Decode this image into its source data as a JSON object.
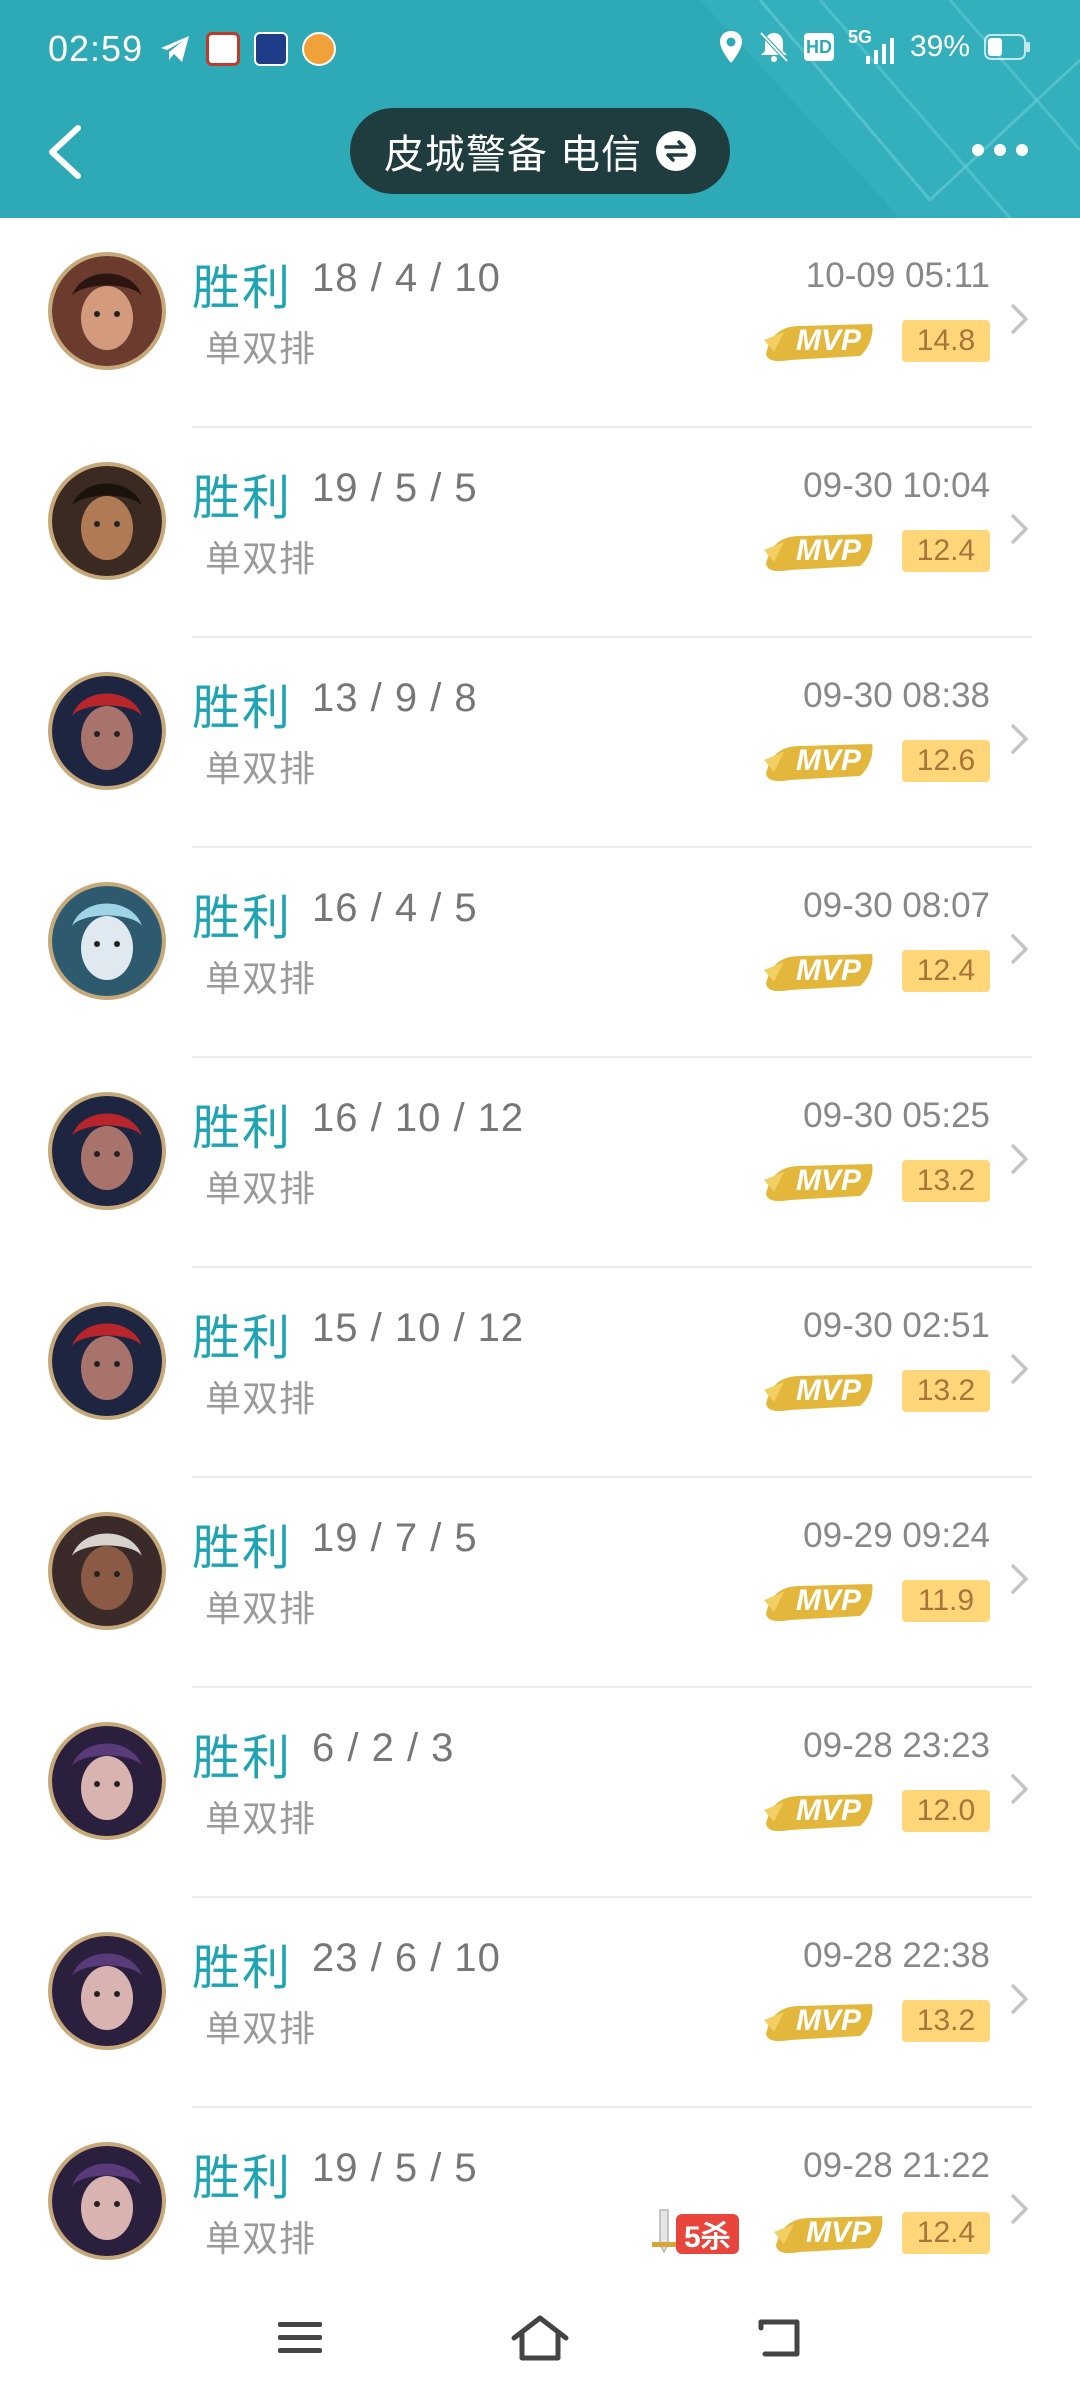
{
  "status_bar": {
    "time": "02:59",
    "network": "5G",
    "hd_label": "HD",
    "battery": "39%"
  },
  "header": {
    "title": "皮城警备 电信",
    "icons": {
      "back": "back-arrow-icon",
      "swap": "swap-icon",
      "more": "more-dots-icon"
    }
  },
  "colors": {
    "header_bg": "#2ea9b6",
    "result_win": "#1fa4b3",
    "score_badge_bg": "#ffd779",
    "mvp_gold": "#e3b73c",
    "penta_red": "#e8453c"
  },
  "matches": [
    {
      "result": "胜利",
      "kda": "18 / 4 / 10",
      "mode": "单双排",
      "time": "10-09 05:11",
      "mvp": "MVP",
      "score": "14.8"
    },
    {
      "result": "胜利",
      "kda": "19 / 5 / 5",
      "mode": "单双排",
      "time": "09-30 10:04",
      "mvp": "MVP",
      "score": "12.4"
    },
    {
      "result": "胜利",
      "kda": "13 / 9 / 8",
      "mode": "单双排",
      "time": "09-30 08:38",
      "mvp": "MVP",
      "score": "12.6"
    },
    {
      "result": "胜利",
      "kda": "16 / 4 / 5",
      "mode": "单双排",
      "time": "09-30 08:07",
      "mvp": "MVP",
      "score": "12.4"
    },
    {
      "result": "胜利",
      "kda": "16 / 10 / 12",
      "mode": "单双排",
      "time": "09-30 05:25",
      "mvp": "MVP",
      "score": "13.2"
    },
    {
      "result": "胜利",
      "kda": "15 / 10 / 12",
      "mode": "单双排",
      "time": "09-30 02:51",
      "mvp": "MVP",
      "score": "13.2"
    },
    {
      "result": "胜利",
      "kda": "19 / 7 / 5",
      "mode": "单双排",
      "time": "09-29 09:24",
      "mvp": "MVP",
      "score": "11.9"
    },
    {
      "result": "胜利",
      "kda": "6 / 2 / 3",
      "mode": "单双排",
      "time": "09-28 23:23",
      "mvp": "MVP",
      "score": "12.0"
    },
    {
      "result": "胜利",
      "kda": "23 / 6 / 10",
      "mode": "单双排",
      "time": "09-28 22:38",
      "mvp": "MVP",
      "score": "13.2"
    },
    {
      "result": "胜利",
      "kda": "19 / 5 / 5",
      "mode": "单双排",
      "time": "09-28 21:22",
      "mvp": "MVP",
      "score": "12.4",
      "penta": "5杀"
    }
  ],
  "nav_bar": {
    "icons": [
      "menu-icon",
      "home-icon",
      "back-icon"
    ]
  }
}
